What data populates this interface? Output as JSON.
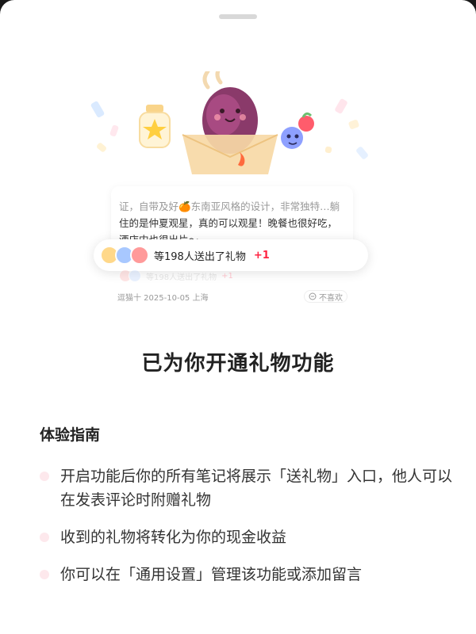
{
  "preview": {
    "post_text_top": "证，自带及好🍊东南亚风格的设计，非常独特…躺",
    "post_text_line2": "住的是仲夏观星，真的可以观星！晚餐也很好吃，",
    "post_text_line3": "酒店内也很出片～",
    "gift_text": "等198人送出了礼物",
    "gift_plus": "+1",
    "ghost_text": "等198人送出了礼物",
    "ghost_plus": "+1",
    "meta_left": "逗猫十  2025-10-05  上海",
    "meta_dislike": "不喜欢"
  },
  "main_title": "已为你开通礼物功能",
  "guide": {
    "title": "体验指南",
    "items": [
      {
        "text": "开启功能后你的所有笔记将展示「送礼物」入口，他人可以在发表评论时附赠礼物"
      },
      {
        "text": "收到的礼物将转化为你的现金收益"
      },
      {
        "text": "你可以在「通用设置」管理该功能或添加留言"
      }
    ]
  },
  "colors": {
    "accent": "#ff2442",
    "bullet": "#fde8ec",
    "title": "#222222"
  },
  "icons": [
    "drag-handle",
    "sweet-potato-gift-illustration",
    "star-jar-icon",
    "berry-gift-icon",
    "dislike-icon"
  ]
}
